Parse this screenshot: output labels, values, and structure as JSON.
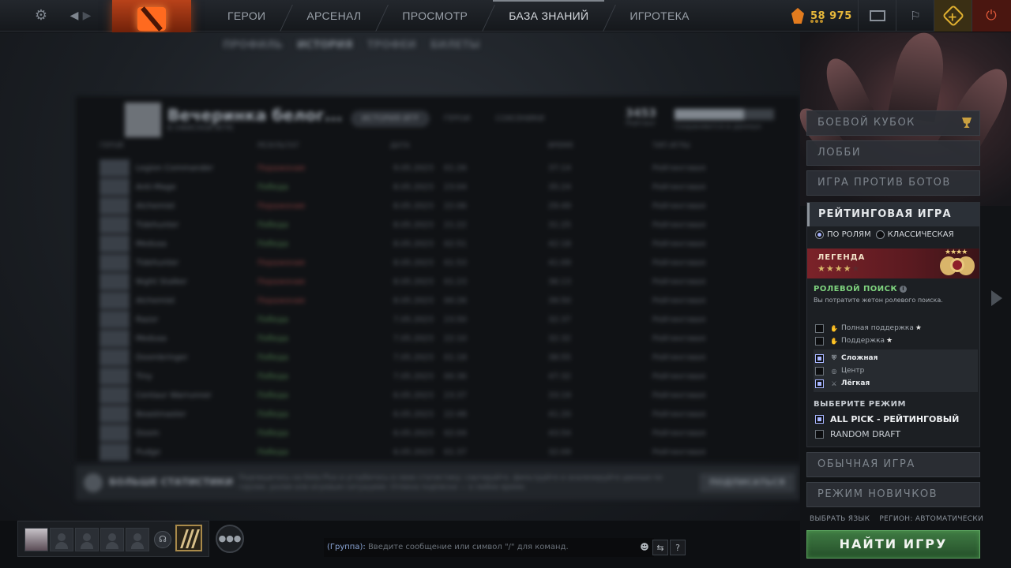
{
  "topbar": {
    "nav": [
      "ГЕРОИ",
      "АРСЕНАЛ",
      "ПРОСМОТР",
      "БАЗА ЗНАНИЙ",
      "ИГРОТЕКА"
    ],
    "active_index": 3,
    "currency_value": "58 975"
  },
  "subnav": [
    "ПРОФИЛЬ",
    "ИСТОРИЯ",
    "ТРОФЕИ",
    "БИЛЕТЫ"
  ],
  "profile": {
    "title": "Вечеринка белог...",
    "subtitle": "В ОФИСНОЙ ИГРЕ",
    "tabs": [
      "ИСТОРИЯ ИГР",
      "ГЕРОИ",
      "СОЮЗНИКИ"
    ],
    "stat_value": "3453",
    "stat_label": "Рейтинг",
    "bar_label": "Сохраняются в данных",
    "columns": [
      "ГЕРОЙ",
      "РЕЗУЛЬТАТ",
      "ДАТА",
      "ВРЕМЯ",
      "ТИП ИГРЫ"
    ],
    "matches": [
      {
        "hero": "Legion Commander",
        "result": "Поражение",
        "win": false,
        "date": "9.05.2023",
        "time": "01:26",
        "duration": "37:14",
        "type": "Рейтинговая"
      },
      {
        "hero": "Anti-Mage",
        "result": "Победа",
        "win": true,
        "date": "8.05.2023",
        "time": "23:04",
        "duration": "35:24",
        "type": "Рейтинговая"
      },
      {
        "hero": "Alchemist",
        "result": "Поражение",
        "win": false,
        "date": "8.05.2023",
        "time": "22:06",
        "duration": "29:49",
        "type": "Рейтинговая"
      },
      {
        "hero": "Tidehunter",
        "result": "Победа",
        "win": true,
        "date": "8.05.2023",
        "time": "21:22",
        "duration": "31:25",
        "type": "Рейтинговая"
      },
      {
        "hero": "Medusa",
        "result": "Победа",
        "win": true,
        "date": "8.05.2023",
        "time": "02:51",
        "duration": "42:18",
        "type": "Рейтинговая"
      },
      {
        "hero": "Tidehunter",
        "result": "Поражение",
        "win": false,
        "date": "8.05.2023",
        "time": "01:53",
        "duration": "41:09",
        "type": "Рейтинговая"
      },
      {
        "hero": "Night Stalker",
        "result": "Поражение",
        "win": false,
        "date": "8.05.2023",
        "time": "01:23",
        "duration": "36:13",
        "type": "Рейтинговая"
      },
      {
        "hero": "Alchemist",
        "result": "Поражение",
        "win": false,
        "date": "8.05.2023",
        "time": "00:26",
        "duration": "39:50",
        "type": "Рейтинговая"
      },
      {
        "hero": "Razor",
        "result": "Победа",
        "win": true,
        "date": "7.05.2023",
        "time": "23:50",
        "duration": "32:37",
        "type": "Рейтинговая"
      },
      {
        "hero": "Medusa",
        "result": "Победа",
        "win": true,
        "date": "7.05.2023",
        "time": "22:10",
        "duration": "32:32",
        "type": "Рейтинговая"
      },
      {
        "hero": "Doombringer",
        "result": "Победа",
        "win": true,
        "date": "7.05.2023",
        "time": "01:18",
        "duration": "38:55",
        "type": "Рейтинговая"
      },
      {
        "hero": "Tiny",
        "result": "Победа",
        "win": true,
        "date": "7.05.2023",
        "time": "00:36",
        "duration": "47:32",
        "type": "Рейтинговая"
      },
      {
        "hero": "Centaur Warrunner",
        "result": "Победа",
        "win": true,
        "date": "6.05.2023",
        "time": "23:37",
        "duration": "33:19",
        "type": "Рейтинговая"
      },
      {
        "hero": "Beastmaster",
        "result": "Победа",
        "win": true,
        "date": "6.05.2023",
        "time": "22:48",
        "duration": "41:20",
        "type": "Рейтинговая"
      },
      {
        "hero": "Doom",
        "result": "Победа",
        "win": true,
        "date": "6.05.2023",
        "time": "02:04",
        "duration": "43:54",
        "type": "Рейтинговая"
      },
      {
        "hero": "Pudge",
        "result": "Победа",
        "win": true,
        "date": "6.05.2023",
        "time": "01:37",
        "duration": "32:09",
        "type": "Рейтинговая"
      }
    ]
  },
  "stats_banner": {
    "title": "БОЛЬШЕ СТАТИСТИКИ",
    "text": "Подпишитесь на Dota Plus и углубитесь в свою статистику: сортируйте, фильтруйте и анализируйте данные по героям, ролям или игровым ситуациям. Отмена подписки — в любое время.",
    "button": "ПОДПИСАТЬСЯ"
  },
  "play_menu": {
    "modes": [
      "БОЕВОЙ КУБОК",
      "ЛОББИ",
      "ИГРА ПРОТИВ БОТОВ"
    ],
    "ranked": {
      "title": "РЕЙТИНГОВАЯ ИГРА",
      "radio_roles": "ПО РОЛЯМ",
      "radio_classic": "КЛАССИЧЕСКАЯ",
      "rank_name": "ЛЕГЕНДА",
      "rank_stars_filled": 4,
      "rank_stars_total": 5,
      "role_search_title": "РОЛЕВОЙ ПОИСК",
      "role_search_desc": "Вы потратите жетон ролевого поиска.",
      "roles": [
        {
          "label": "Полная поддержка",
          "star": true,
          "checked": false,
          "icon": "hand-icon"
        },
        {
          "label": "Поддержка",
          "star": true,
          "checked": false,
          "icon": "hand-icon"
        },
        {
          "label": "Сложная",
          "star": false,
          "checked": true,
          "icon": "shield-icon"
        },
        {
          "label": "Центр",
          "star": false,
          "checked": false,
          "icon": "target-icon"
        },
        {
          "label": "Лёгкая",
          "star": false,
          "checked": true,
          "icon": "sword-icon"
        }
      ],
      "select_mode_title": "ВЫБЕРИТЕ РЕЖИМ",
      "game_modes": [
        {
          "label": "ALL PICK - РЕЙТИНГОВЫЙ",
          "checked": true
        },
        {
          "label": "RANDOM DRAFT",
          "checked": false
        }
      ]
    },
    "normal": "ОБЫЧНАЯ ИГРА",
    "newbie": "РЕЖИМ НОВИЧКОВ",
    "language": "ВЫБРАТЬ ЯЗЫК",
    "region": "РЕГИОН: АВТОМАТИЧЕСКИ",
    "find_button": "НАЙТИ ИГРУ"
  },
  "chat": {
    "prefix": "(Группа):",
    "placeholder": "Введите сообщение или символ \"/\" для команд."
  },
  "colors": {
    "accent_orange": "#e0601f",
    "currency_gold": "#e6b73a",
    "find_green": "#3f7a43",
    "rank_red": "#7b2229",
    "role_green": "#7ed37e"
  }
}
